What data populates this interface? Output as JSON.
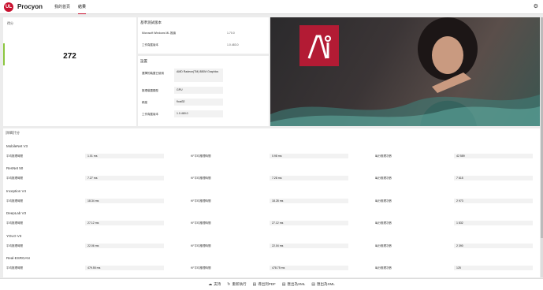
{
  "app": {
    "title": "Procyon"
  },
  "nav": {
    "tabs": [
      {
        "label": "我的首頁"
      },
      {
        "label": "結果"
      }
    ]
  },
  "score": {
    "label": "得分",
    "value": "272"
  },
  "info": {
    "title": "基準測試版本",
    "rows": [
      {
        "label": "Microsoft Windows ML 推論",
        "value": "1.70.0"
      },
      {
        "label": "工作負載版本",
        "value": "1.0.483.0"
      }
    ]
  },
  "settings": {
    "title": "設置",
    "rows": [
      {
        "label": "選擇的裝置已使用",
        "value": "AMD Radeon(TM) 880M Graphics"
      },
      {
        "label": "推理裝置類型",
        "value": "GPU"
      },
      {
        "label": "精度",
        "value": "float32"
      },
      {
        "label": "工作負載版本",
        "value": "1.0.469.0"
      }
    ]
  },
  "results": {
    "title": "詳細計分",
    "col_labels": [
      "平均推理時間",
      "KF平均推理時間",
      "每分推理次數"
    ],
    "tests": [
      {
        "name": "MobileNet V3",
        "values": [
          "1.01 ms",
          "0.98 ms",
          "42 589"
        ]
      },
      {
        "name": "ResNet 50",
        "values": [
          "7.27 ms",
          "7.28 ms",
          "7 615"
        ]
      },
      {
        "name": "Inception V4",
        "values": [
          "18.34 ms",
          "18.28 ms",
          "2 973"
        ]
      },
      {
        "name": "DeepLab V3",
        "values": [
          "27.12 ms",
          "27.12 ms",
          "1 832"
        ]
      },
      {
        "name": "YOLO V3",
        "values": [
          "22.06 ms",
          "22.04 ms",
          "2 390"
        ]
      },
      {
        "name": "Real-ESRGAN",
        "values": [
          "479.55 ms",
          "478.75 ms",
          "125"
        ]
      }
    ]
  },
  "bottom": {
    "buttons": [
      {
        "label": "支持",
        "icon": "cloud-icon"
      },
      {
        "label": "重新執行",
        "icon": "refresh-icon"
      },
      {
        "label": "導出到PDF",
        "icon": "pdf-icon"
      },
      {
        "label": "匯出為XML",
        "icon": "xml-icon"
      },
      {
        "label": "匯出為XML",
        "icon": "xml-icon"
      }
    ]
  },
  "colors": {
    "accent": "#c8102e",
    "score_bar": "#8cc63f",
    "ai_logo": "#b31b34"
  }
}
